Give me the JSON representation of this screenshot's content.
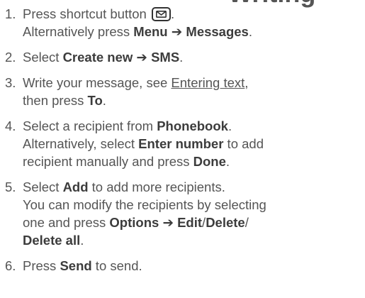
{
  "heading_fragment": "Writing",
  "steps": [
    {
      "number": "1.",
      "lines": [
        [
          {
            "t": "Press shortcut button "
          }
        ],
        [
          {
            "t": "Alternatively press "
          },
          {
            "kw": "Menu"
          },
          {
            "t": " "
          },
          {
            "arrow": "➔"
          },
          {
            "t": " "
          },
          {
            "kw": "Messages"
          },
          {
            "t": "."
          }
        ]
      ]
    },
    {
      "number": "2.",
      "lines": [
        [
          {
            "t": "Select "
          },
          {
            "kw": "Create new"
          },
          {
            "t": " "
          },
          {
            "arrow": "➔"
          },
          {
            "t": " "
          },
          {
            "kw": "SMS"
          },
          {
            "t": "."
          }
        ]
      ]
    },
    {
      "number": "3.",
      "lines": [
        [
          {
            "t": "Write your message, see "
          },
          {
            "link": "Entering text"
          },
          {
            "t": ","
          }
        ],
        [
          {
            "t": "then press "
          },
          {
            "kw": "To"
          },
          {
            "t": "."
          }
        ]
      ]
    },
    {
      "number": "4.",
      "lines": [
        [
          {
            "t": "Select a recipient from "
          },
          {
            "kw": "Phonebook"
          },
          {
            "t": "."
          }
        ],
        [
          {
            "t": "Alternatively, select "
          },
          {
            "kw": "Enter number"
          },
          {
            "t": " to add"
          }
        ],
        [
          {
            "t": "recipient manually and press "
          },
          {
            "kw": "Done"
          },
          {
            "t": "."
          }
        ]
      ]
    },
    {
      "number": "5.",
      "lines": [
        [
          {
            "t": "Select "
          },
          {
            "kw": "Add"
          },
          {
            "t": " to add more recipients."
          }
        ],
        [
          {
            "t": "You can modify the recipients by selecting"
          }
        ],
        [
          {
            "t": "one and press "
          },
          {
            "kw": "Options"
          },
          {
            "t": " "
          },
          {
            "arrow": "➔"
          },
          {
            "t": " "
          },
          {
            "kw": "Edit"
          },
          {
            "t": "/"
          },
          {
            "kw": "Delete"
          },
          {
            "t": "/"
          }
        ],
        [
          {
            "kw": "Delete all"
          },
          {
            "t": "."
          }
        ]
      ]
    },
    {
      "number": "6.",
      "lines": [
        [
          {
            "t": "Press "
          },
          {
            "kw": "Send"
          },
          {
            "t": " to send."
          }
        ]
      ]
    }
  ],
  "icons": {
    "shortcut_button": "message-envelope-icon"
  }
}
